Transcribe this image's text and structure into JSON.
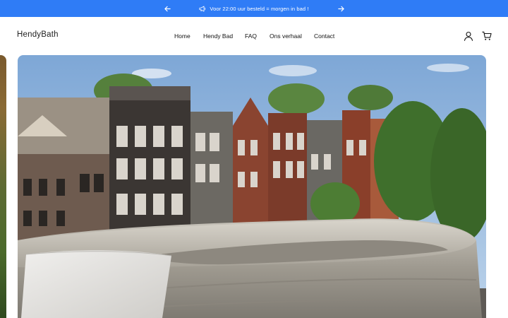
{
  "announcement": {
    "message": "Voor 22:00 uur besteld = morgen in bad !",
    "icons": {
      "prev": "arrow-left-icon",
      "next": "arrow-right-icon",
      "shipping": "megaphone-icon"
    }
  },
  "header": {
    "logo": "HendyBath",
    "nav": [
      "Home",
      "Hendy Bad",
      "FAQ",
      "Ons verhaal",
      "Contact"
    ],
    "icons": {
      "account": "user-icon",
      "cart": "cart-icon"
    }
  },
  "hero": {
    "image": "inflatable-bath-on-amsterdam-balcony",
    "colors": {
      "sky": "#8fb3d9",
      "brick": "#7a3b28",
      "bath": "#bdb8ad",
      "towel": "#e7e6e3"
    }
  },
  "colors": {
    "accent": "#2f7cf6",
    "text": "#111111",
    "background": "#ffffff"
  }
}
